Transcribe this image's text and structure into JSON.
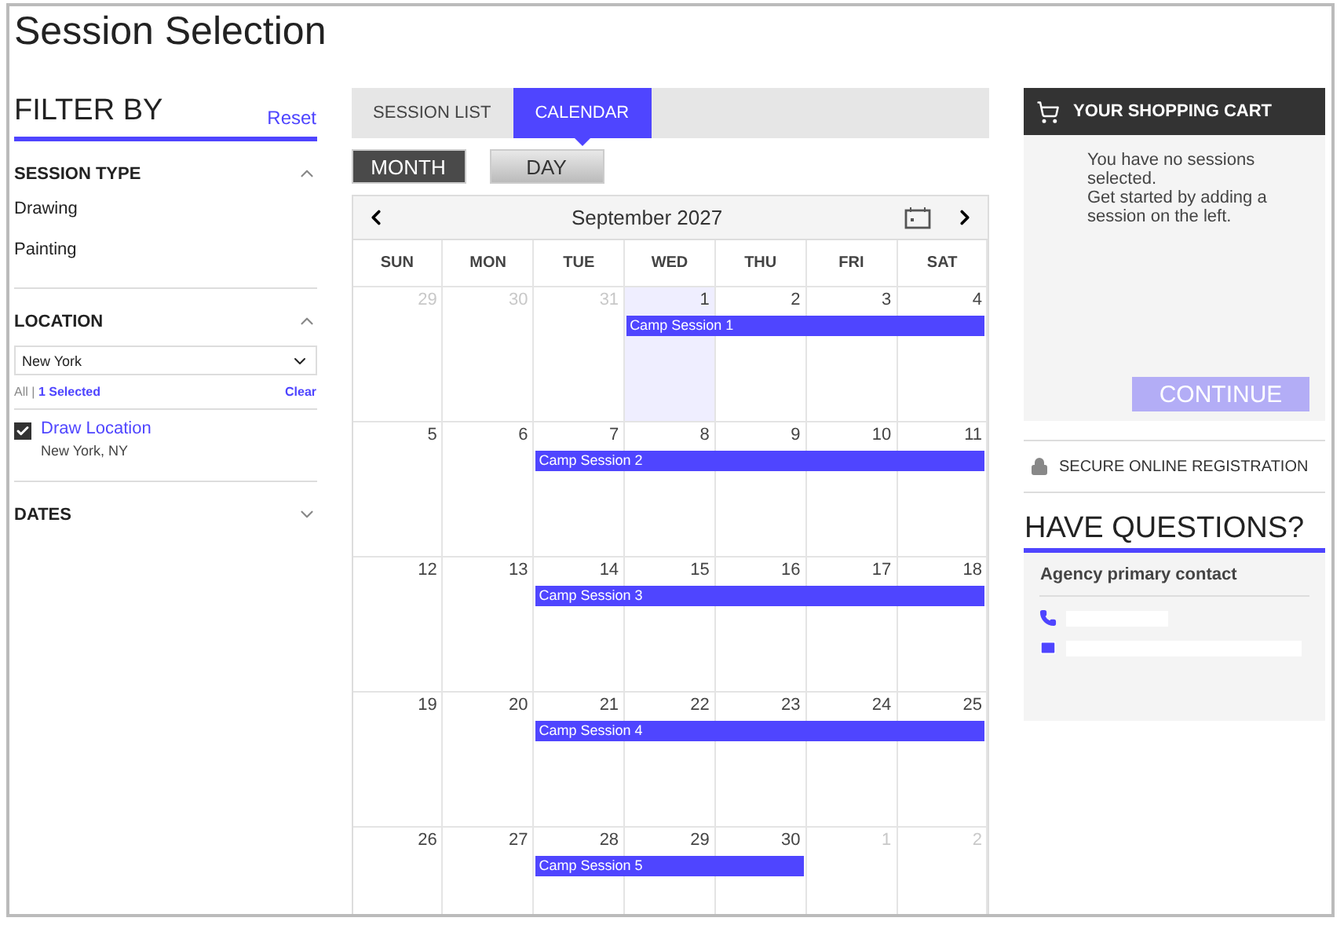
{
  "page_title": "Session Selection",
  "filter": {
    "title": "FILTER BY",
    "reset": "Reset",
    "sections": [
      {
        "kind": "list",
        "title": "SESSION TYPE",
        "expanded": true,
        "items": [
          "Drawing",
          "Painting"
        ]
      },
      {
        "kind": "location",
        "title": "LOCATION",
        "expanded": true,
        "select_value": "New York",
        "all": "All",
        "separator": "|",
        "selected_count": "1 Selected",
        "clear": "Clear",
        "options": [
          {
            "name": "Draw Location",
            "address": "New York, NY",
            "checked": true
          }
        ]
      },
      {
        "kind": "dates",
        "title": "DATES",
        "expanded": false
      }
    ]
  },
  "tabs": [
    {
      "label": "SESSION LIST",
      "selected": false
    },
    {
      "label": "CALENDAR",
      "selected": true
    }
  ],
  "views": [
    {
      "label": "MONTH",
      "selected": true
    },
    {
      "label": "DAY",
      "selected": false
    }
  ],
  "calendar": {
    "month": "September 2027",
    "weekdays": [
      "SUN",
      "MON",
      "TUE",
      "WED",
      "THU",
      "FRI",
      "SAT"
    ],
    "weeks": [
      {
        "session": "Camp Session 1",
        "days": [
          {
            "n": "29",
            "muted": true,
            "today": false,
            "in_session": false
          },
          {
            "n": "30",
            "muted": true,
            "today": false,
            "in_session": false
          },
          {
            "n": "31",
            "muted": true,
            "today": false,
            "in_session": false
          },
          {
            "n": "1",
            "muted": false,
            "today": true,
            "in_session": true
          },
          {
            "n": "2",
            "muted": false,
            "today": false,
            "in_session": true
          },
          {
            "n": "3",
            "muted": false,
            "today": false,
            "in_session": true
          },
          {
            "n": "4",
            "muted": false,
            "today": false,
            "in_session": true
          }
        ]
      },
      {
        "session": "Camp Session 2",
        "days": [
          {
            "n": "5",
            "muted": false,
            "today": false,
            "in_session": false
          },
          {
            "n": "6",
            "muted": false,
            "today": false,
            "in_session": false
          },
          {
            "n": "7",
            "muted": false,
            "today": false,
            "in_session": true
          },
          {
            "n": "8",
            "muted": false,
            "today": false,
            "in_session": true
          },
          {
            "n": "9",
            "muted": false,
            "today": false,
            "in_session": true
          },
          {
            "n": "10",
            "muted": false,
            "today": false,
            "in_session": true
          },
          {
            "n": "11",
            "muted": false,
            "today": false,
            "in_session": true
          }
        ]
      },
      {
        "session": "Camp Session 3",
        "days": [
          {
            "n": "12",
            "muted": false,
            "today": false,
            "in_session": false
          },
          {
            "n": "13",
            "muted": false,
            "today": false,
            "in_session": false
          },
          {
            "n": "14",
            "muted": false,
            "today": false,
            "in_session": true
          },
          {
            "n": "15",
            "muted": false,
            "today": false,
            "in_session": true
          },
          {
            "n": "16",
            "muted": false,
            "today": false,
            "in_session": true
          },
          {
            "n": "17",
            "muted": false,
            "today": false,
            "in_session": true
          },
          {
            "n": "18",
            "muted": false,
            "today": false,
            "in_session": true
          }
        ]
      },
      {
        "session": "Camp Session 4",
        "days": [
          {
            "n": "19",
            "muted": false,
            "today": false,
            "in_session": false
          },
          {
            "n": "20",
            "muted": false,
            "today": false,
            "in_session": false
          },
          {
            "n": "21",
            "muted": false,
            "today": false,
            "in_session": true
          },
          {
            "n": "22",
            "muted": false,
            "today": false,
            "in_session": true
          },
          {
            "n": "23",
            "muted": false,
            "today": false,
            "in_session": true
          },
          {
            "n": "24",
            "muted": false,
            "today": false,
            "in_session": true
          },
          {
            "n": "25",
            "muted": false,
            "today": false,
            "in_session": true
          }
        ]
      },
      {
        "session": "Camp Session 5",
        "days": [
          {
            "n": "26",
            "muted": false,
            "today": false,
            "in_session": false
          },
          {
            "n": "27",
            "muted": false,
            "today": false,
            "in_session": false
          },
          {
            "n": "28",
            "muted": false,
            "today": false,
            "in_session": true
          },
          {
            "n": "29",
            "muted": false,
            "today": false,
            "in_session": true
          },
          {
            "n": "30",
            "muted": false,
            "today": false,
            "in_session": true
          },
          {
            "n": "1",
            "muted": true,
            "today": false,
            "in_session": false
          },
          {
            "n": "2",
            "muted": true,
            "today": false,
            "in_session": false
          }
        ]
      }
    ]
  },
  "cart": {
    "title": "YOUR SHOPPING CART",
    "message": [
      "You have no sessions selected.",
      "Get started by adding a session on the left."
    ],
    "button": "CONTINUE",
    "button_disabled": true
  },
  "secure": "SECURE ONLINE REGISTRATION",
  "questions": {
    "title": "HAVE QUESTIONS?",
    "contact_title": "Agency primary contact"
  }
}
